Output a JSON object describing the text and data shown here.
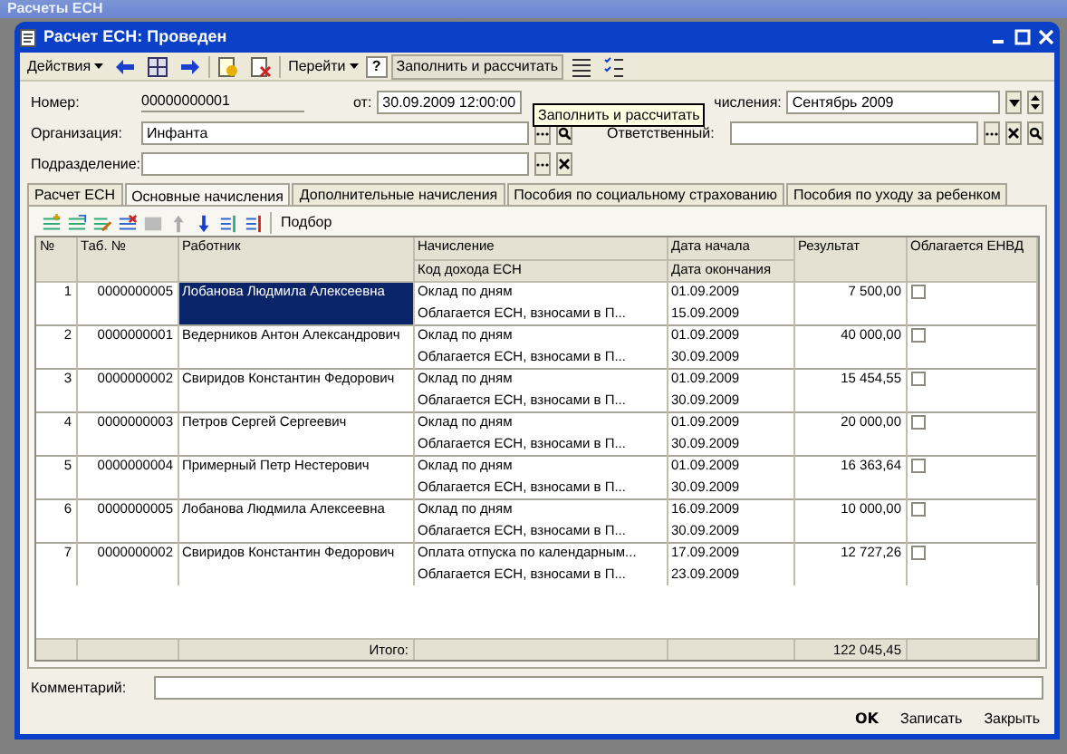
{
  "outer_window": {
    "title": "Расчеты ЕСН"
  },
  "window": {
    "title": "Расчет ЕСН: Проведен"
  },
  "toolbar": [
    {
      "kind": "menu",
      "label": "Действия"
    },
    {
      "kind": "icon"
    },
    {
      "kind": "icon"
    },
    {
      "kind": "icon"
    },
    {
      "kind": "sep"
    },
    {
      "kind": "icon"
    },
    {
      "kind": "icon"
    },
    {
      "kind": "sep"
    },
    {
      "kind": "menu",
      "label": "Перейти"
    },
    {
      "kind": "help",
      "label": "?"
    },
    {
      "kind": "button",
      "label": "Заполнить и рассчитать"
    },
    {
      "kind": "icon"
    },
    {
      "kind": "icon"
    }
  ],
  "tooltip": "Заполнить и рассчитать",
  "fields": {
    "number_label": "Номер:",
    "number": "00000000001",
    "date_label": "от:",
    "date": "30.09.2009 12:00:00",
    "period_label": "числения:",
    "period": "Сентябрь 2009",
    "org_label": "Организация:",
    "org": "Инфанта",
    "responsible_label": "Ответственный:",
    "dept_label": "Подразделение:"
  },
  "tabs": [
    {
      "label": "Расчет ЕСН",
      "selected": false
    },
    {
      "label": "Основные начисления",
      "selected": true
    },
    {
      "label": "Дополнительные начисления",
      "selected": false
    },
    {
      "label": "Пособия по социальному страхованию",
      "selected": false
    },
    {
      "label": "Пособия по уходу за ребенком",
      "selected": false
    }
  ],
  "table_toolbar": {
    "pick_label": "Подбор"
  },
  "table": {
    "columns": [
      "№",
      "Таб. №",
      "Работник",
      "Начисление",
      "Код дохода ЕСН",
      "Дата начала",
      "Дата окончания",
      "Результат",
      "Облагается ЕНВД"
    ],
    "rows": [
      {
        "n": "1",
        "tab": "0000000005",
        "employee": "Лобанова Людмила Алексеевна",
        "accrual": "Оклад по дням",
        "code": "Облагается ЕСН, взносами в П...",
        "start": "01.09.2009",
        "end": "15.09.2009",
        "result": "7 500,00",
        "envd": false,
        "selected": true
      },
      {
        "n": "2",
        "tab": "0000000001",
        "employee": "Ведерников  Антон Александрович",
        "accrual": "Оклад по дням",
        "code": "Облагается ЕСН, взносами в П...",
        "start": "01.09.2009",
        "end": "30.09.2009",
        "result": "40 000,00",
        "envd": false,
        "selected": false
      },
      {
        "n": "3",
        "tab": "0000000002",
        "employee": "Свиридов Константин Федорович",
        "accrual": "Оклад по дням",
        "code": "Облагается ЕСН, взносами в П...",
        "start": "01.09.2009",
        "end": "30.09.2009",
        "result": "15 454,55",
        "envd": false,
        "selected": false
      },
      {
        "n": "4",
        "tab": "0000000003",
        "employee": "Петров Сергей Сергеевич",
        "accrual": "Оклад по дням",
        "code": "Облагается ЕСН, взносами в П...",
        "start": "01.09.2009",
        "end": "30.09.2009",
        "result": "20 000,00",
        "envd": false,
        "selected": false
      },
      {
        "n": "5",
        "tab": "0000000004",
        "employee": "Примерный Петр Нестерович",
        "accrual": "Оклад по дням",
        "code": "Облагается ЕСН, взносами в П...",
        "start": "01.09.2009",
        "end": "30.09.2009",
        "result": "16 363,64",
        "envd": false,
        "selected": false
      },
      {
        "n": "6",
        "tab": "0000000005",
        "employee": "Лобанова Людмила Алексеевна",
        "accrual": "Оклад по дням",
        "code": "Облагается ЕСН, взносами в П...",
        "start": "16.09.2009",
        "end": "30.09.2009",
        "result": "10 000,00",
        "envd": false,
        "selected": false
      },
      {
        "n": "7",
        "tab": "0000000002",
        "employee": "Свиридов Константин Федорович",
        "accrual": "Оплата отпуска по календарным...",
        "code": "Облагается ЕСН, взносами в П...",
        "start": "17.09.2009",
        "end": "23.09.2009",
        "result": "12 727,26",
        "envd": false,
        "selected": false
      }
    ],
    "total_label": "Итого:",
    "total": "122 045,45"
  },
  "comment_label": "Комментарий:",
  "buttons": [
    {
      "label": "OK",
      "kind": "default"
    },
    {
      "label": "Записать",
      "kind": "plain"
    },
    {
      "label": "Закрыть",
      "kind": "plain"
    }
  ]
}
